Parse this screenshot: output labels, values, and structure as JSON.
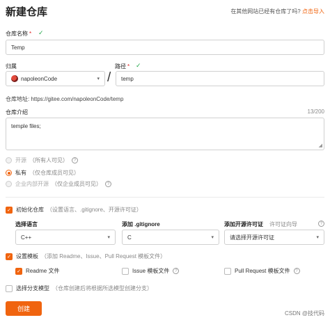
{
  "header": {
    "title": "新建仓库",
    "import_text": "在其他网站已经有仓库了吗?",
    "import_link": "点击导入"
  },
  "repo_name": {
    "label": "仓库名称",
    "required_mark": "*",
    "value": "Temp"
  },
  "owner": {
    "label": "归属",
    "value": "napoleonCode"
  },
  "path": {
    "label": "路径",
    "required_mark": "*",
    "value": "temp",
    "separator": "/"
  },
  "repo_url": "仓库地址: https://gitee.com/napoleonCode/temp",
  "description": {
    "label": "仓库介绍",
    "counter": "13/200",
    "value": "temple files;"
  },
  "visibility": {
    "options": [
      {
        "label": "开源",
        "hint": "（所有人可见）",
        "state": "disabled"
      },
      {
        "label": "私有",
        "hint": "（仅仓库成员可见）",
        "state": "selected"
      },
      {
        "label": "企业内部开源",
        "hint": "（仅企业成员可见）",
        "state": "disabled"
      }
    ]
  },
  "init_repo": {
    "label": "初始化仓库",
    "hint": "（设置语言、.gitignore、开源许可证）",
    "checked": true
  },
  "language": {
    "label": "选择语言",
    "value": "C++"
  },
  "gitignore": {
    "label": "添加 .gitignore",
    "value": "C"
  },
  "license": {
    "label": "添加开源许可证",
    "helper": "许可证向导",
    "value": "请选择开源许可证"
  },
  "template": {
    "label": "设置模板",
    "hint": "（添加 Readme、Issue、Pull Request 模板文件）",
    "checked": true
  },
  "template_files": {
    "readme": {
      "label": "Readme 文件",
      "checked": true
    },
    "issue": {
      "label": "Issue 模板文件",
      "checked": false
    },
    "pr": {
      "label": "Pull Request 模板文件",
      "checked": false
    }
  },
  "branch_model": {
    "label": "选择分支模型",
    "hint": "（仓库创建后将根据所选模型创建分支）",
    "checked": false
  },
  "actions": {
    "create_label": "创建"
  },
  "watermark": "CSDN @技代码",
  "colors": {
    "accent": "#f0640f",
    "success": "#22a84a",
    "required": "#e02020"
  },
  "icons": {
    "valid": "checkmark-icon",
    "help": "question-circle-icon",
    "dropdown": "chevron-down-icon"
  }
}
